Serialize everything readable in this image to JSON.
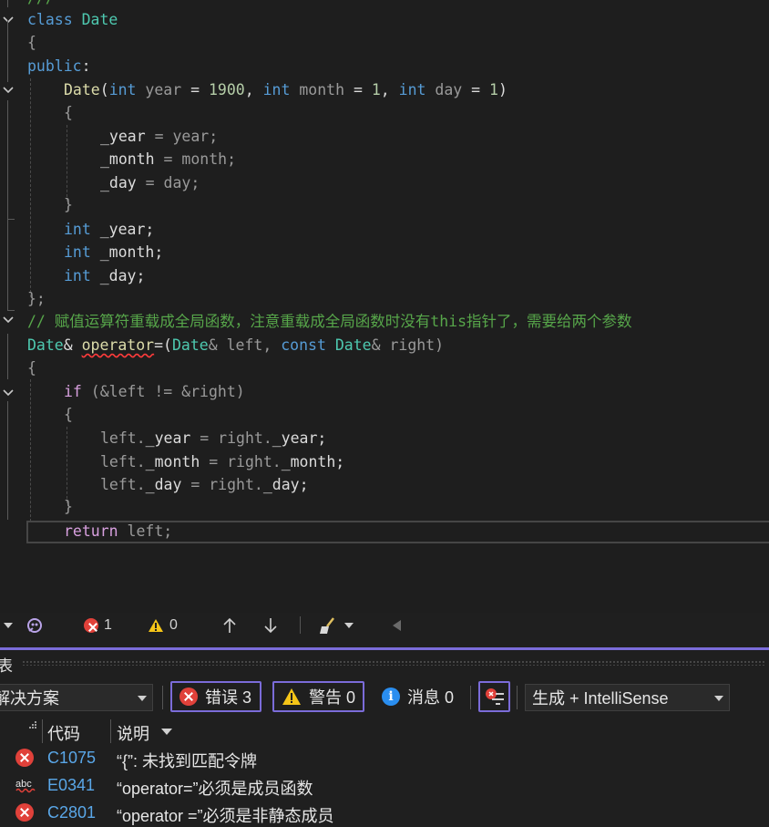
{
  "editor": {
    "line0": "///",
    "class_kw": "class",
    "class_name": "Date",
    "open_brace": "{",
    "public_kw": "public",
    "colon": ":",
    "ctor": {
      "name": "Date",
      "p_open": "(",
      "int1": "int",
      "year": " year",
      "eq1": " = ",
      "n1900": "1900",
      "comma1": ", ",
      "int2": "int",
      "month": " month",
      "eq2": " = ",
      "n1a": "1",
      "comma2": ", ",
      "int3": "int",
      "day": " day",
      "eq3": " = ",
      "n1b": "1",
      "p_close": ")"
    },
    "ctor_open": "{",
    "assign_year_l": "_year",
    "assign_year_r": " = year;",
    "assign_month_l": "_month",
    "assign_month_r": " = month;",
    "assign_day_l": "_day",
    "assign_day_r": " = day;",
    "ctor_close": "}",
    "member_int": "int",
    "m_year": " _year;",
    "m_month": " _month;",
    "m_day": " _day;",
    "class_close": "};",
    "comment": "// 赋值运算符重载成全局函数，注意重载成全局函数时没有this指针了，需要给两个参数",
    "op_ret_type": "Date",
    "op_amp": "& ",
    "op_kw": "operator",
    "op_sig_a": "=(",
    "op_t1": "Date",
    "op_left": "& left, ",
    "op_const": "const ",
    "op_t2": "Date",
    "op_right": "& right)",
    "fn_open": "{",
    "if_kw": "if",
    "if_cond": " (&left != &right)",
    "if_open": "{",
    "s1_a": "left.",
    "s1_b": "_year",
    "s1_c": " = right.",
    "s1_d": "_year",
    "s1_e": ";",
    "s2_a": "left.",
    "s2_b": "_month",
    "s2_c": " = right.",
    "s2_d": "_month",
    "s2_e": ";",
    "s3_a": "left.",
    "s3_b": "_day",
    "s3_c": " = right.",
    "s3_d": "_day",
    "s3_e": ";",
    "if_close": "}",
    "ret_kw": "return",
    "ret_val": " left;"
  },
  "statusbar": {
    "errors": "1",
    "warnings": "0"
  },
  "error_list": {
    "title": "表",
    "scope": "解决方案",
    "errors_btn": "错误 3",
    "warnings_btn": "警告 0",
    "messages_btn": "消息 0",
    "build_filter": "生成 + IntelliSense",
    "col_code": "代码",
    "col_desc": "说明",
    "rows": [
      {
        "code": "C1075",
        "desc": "“{”: 未找到匹配令牌",
        "icon": "error-icon"
      },
      {
        "code": "E0341",
        "desc": "“operator=”必须是成员函数",
        "icon": "intellisense-abc-icon"
      },
      {
        "code": "C2801",
        "desc": "“operator =”必须是非静态成员",
        "icon": "error-icon"
      }
    ]
  },
  "colors": {
    "accent": "#7b6cd9",
    "error": "#e0413a",
    "warning": "#f5c518",
    "info": "#2a8ef0",
    "code_link": "#5aa7e8"
  }
}
